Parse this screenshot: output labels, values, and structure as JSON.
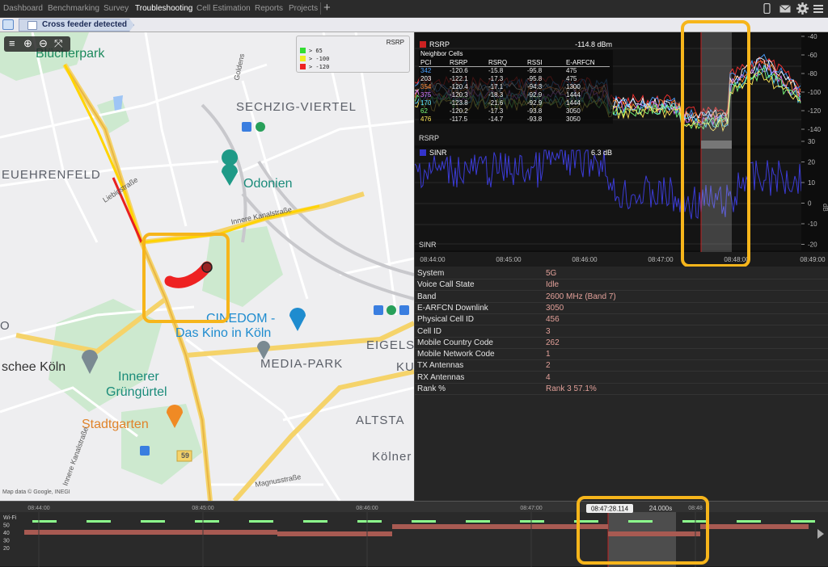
{
  "nav": {
    "items": [
      "Dashboard",
      "Benchmarking",
      "Survey",
      "Troubleshooting",
      "Cell Estimation",
      "Reports",
      "Projects"
    ],
    "active_index": 3,
    "add_label": "+",
    "icons": [
      "phone-icon",
      "mail-icon",
      "gear-icon",
      "menu-icon"
    ]
  },
  "breadcrumb": {
    "label": "Cross feeder detected"
  },
  "map": {
    "districts": {
      "buecherpark": "Blücherpark",
      "sechzig": "SECHZIG-VIERTEL",
      "ehrenfeld": "EUEHRENFELD",
      "mediapark": "MEDIA-PARK",
      "eigelstein": "EIGELS",
      "altstadt": "ALTSTA",
      "ku": "KU",
      "koelner": "Kölner"
    },
    "pois": {
      "odonien": "Odonien",
      "cinedom1": "CINEDOM -",
      "cinedom2": "Das Kino in Köln",
      "moschee": "schee Köln",
      "gruen1": "Innerer",
      "gruen2": "Grüngürtel",
      "stadtgarten": "Stadtgarten",
      "o": "O"
    },
    "streets": {
      "liebig": "Liebigstraße",
      "innerekanal": "Innere Kanalstraße",
      "goldens": "Goldens",
      "kanal2": "Innere Kanalstraße",
      "magnus": "Magnusstraße",
      "road59": "59"
    },
    "attribution": "Map data © Google, INEGI",
    "tools": [
      "≡",
      "⊕",
      "⊖",
      "⤧"
    ],
    "legend": {
      "title": "RSRP",
      "rows": [
        {
          "label": ">  65",
          "color": "#33dd33"
        },
        {
          "label": ">  -100",
          "color": "#eeee22"
        },
        {
          "label": ">  -120",
          "color": "#ee2222"
        }
      ]
    }
  },
  "chart": {
    "rsrp_title": "RSRP",
    "rsrp_value": "-114.8 dBm",
    "rsrp_axis_label": "RSRP",
    "sinr_title": "SINR",
    "sinr_value": "6.3 dB",
    "sinr_axis_label": "SINR",
    "sinr_unit": "dB",
    "neighbor_title": "Neighbor Cells",
    "neighbor_headers": [
      "PCI",
      "RSRP",
      "RSRQ",
      "RSSI",
      "E-ARFCN"
    ],
    "neighbor_rows": [
      [
        "342",
        "-120.6",
        "-15.8",
        "-95.8",
        "475"
      ],
      [
        "203",
        "-122.1",
        "-17.3",
        "-95.8",
        "475"
      ],
      [
        "354",
        "-120.4",
        "-17.1",
        "-94.3",
        "1300"
      ],
      [
        "375",
        "-120.3",
        "-18.3",
        "-92.9",
        "1444"
      ],
      [
        "170",
        "-123.8",
        "-21.6",
        "-92.9",
        "1444"
      ],
      [
        "62",
        "-120.2",
        "-17.3",
        "-93.8",
        "3050"
      ],
      [
        "476",
        "-117.5",
        "-14.7",
        "-93.8",
        "3050"
      ]
    ],
    "neighbor_colors": [
      "#4aa0ff",
      "#ffffff",
      "#ff8a3a",
      "#d27cff",
      "#5ee0ff",
      "#7cff7c",
      "#ffe85a"
    ],
    "rsrp_ticks": [
      "-40",
      "-60",
      "-80",
      "-100",
      "-120",
      "-140"
    ],
    "sinr_ticks": [
      "30",
      "20",
      "10",
      "0",
      "-10",
      "-20"
    ],
    "time_ticks": [
      "08:44:00",
      "08:45:00",
      "08:46:00",
      "08:47:00",
      "08:48:00",
      "08:49:00"
    ]
  },
  "chart_data": {
    "type": "line",
    "series": [
      {
        "name": "RSRP",
        "unit": "dBm",
        "ylim": [
          -140,
          -40
        ],
        "current": -114.8
      },
      {
        "name": "SINR",
        "unit": "dB",
        "ylim": [
          -20,
          30
        ],
        "current": 6.3
      }
    ]
  },
  "params": [
    {
      "k": "System",
      "v": "5G"
    },
    {
      "k": "Voice Call State",
      "v": "Idle"
    },
    {
      "k": "Band",
      "v": "2600 MHz (Band 7)"
    },
    {
      "k": "E-ARFCN Downlink",
      "v": "3050"
    },
    {
      "k": "Physical Cell ID",
      "v": "456"
    },
    {
      "k": "Cell ID",
      "v": "3"
    },
    {
      "k": "Mobile Country Code",
      "v": "262"
    },
    {
      "k": "Mobile Network Code",
      "v": "1"
    },
    {
      "k": "TX Antennas",
      "v": "2"
    },
    {
      "k": "RX Antennas",
      "v": "4"
    },
    {
      "k": "Rank %",
      "v": "Rank 3 57.1%"
    }
  ],
  "timeline": {
    "row_labels": [
      "Wi-Fi",
      "50",
      "40",
      "30",
      "20"
    ],
    "time_ticks": [
      "08:44:00",
      "08:45:00",
      "08:46:00",
      "08:47:00",
      "08:48"
    ],
    "cursor_time": "08:47:28.114",
    "window_duration": "24.000s"
  },
  "colors": {
    "highlight": "#f6b51b",
    "rsrp_red": "#ee2222",
    "sinr_blue": "#3333dd",
    "wifi_green": "#8cff8c",
    "lte_band": "#b06058"
  }
}
